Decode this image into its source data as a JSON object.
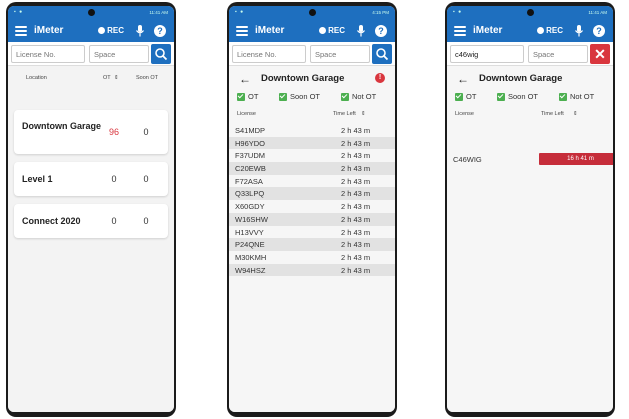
{
  "app": {
    "title": "iMeter",
    "rec_label": "REC",
    "help_label": "?"
  },
  "colors": {
    "primary": "#1e6fbf",
    "danger": "#d9363e",
    "check_green": "#4caf50"
  },
  "icons": [
    "menu-icon",
    "mic-icon",
    "help-icon",
    "search-icon",
    "close-icon",
    "back-arrow-icon",
    "alert-icon",
    "sort-icon"
  ],
  "search": {
    "license_placeholder": "License No.",
    "space_placeholder": "Space"
  },
  "screen1": {
    "status_time": "11:41 AM",
    "columns": {
      "location": "Location",
      "ot": "OT",
      "soon_ot": "Soon OT"
    },
    "locations": [
      {
        "name": "Downtown Garage",
        "ot": "96",
        "soon_ot": "0"
      },
      {
        "name": "Level 1",
        "ot": "0",
        "soon_ot": "0"
      },
      {
        "name": "Connect 2020",
        "ot": "0",
        "soon_ot": "0"
      }
    ]
  },
  "screen2": {
    "status_time": "4:15 PM",
    "title": "Downtown Garage",
    "filters": {
      "ot": "OT",
      "soon_ot": "Soon OT",
      "not_ot": "Not OT"
    },
    "columns": {
      "license": "License",
      "time_left": "Time Left"
    },
    "plates": [
      {
        "license": "S41MDP",
        "time_left": "2 h 43 m"
      },
      {
        "license": "H96YDO",
        "time_left": "2 h 43 m"
      },
      {
        "license": "F37UDM",
        "time_left": "2 h 43 m"
      },
      {
        "license": "C20EWB",
        "time_left": "2 h 43 m"
      },
      {
        "license": "F72ASA",
        "time_left": "2 h 43 m"
      },
      {
        "license": "Q33LPQ",
        "time_left": "2 h 43 m"
      },
      {
        "license": "X60GDY",
        "time_left": "2 h 43 m"
      },
      {
        "license": "W16SHW",
        "time_left": "2 h 43 m"
      },
      {
        "license": "H13VVY",
        "time_left": "2 h 43 m"
      },
      {
        "license": "P24QNE",
        "time_left": "2 h 43 m"
      },
      {
        "license": "M30KMH",
        "time_left": "2 h 43 m"
      },
      {
        "license": "W94HSZ",
        "time_left": "2 h 43 m"
      }
    ]
  },
  "screen3": {
    "status_time": "11:41 AM",
    "search_value": "c46wig",
    "title": "Downtown Garage",
    "filters": {
      "ot": "OT",
      "soon_ot": "Soon OT",
      "not_ot": "Not OT"
    },
    "columns": {
      "license": "License",
      "time_left": "Time Left"
    },
    "result": {
      "license": "C46WIG",
      "time_left": "16 h 41 m"
    }
  }
}
